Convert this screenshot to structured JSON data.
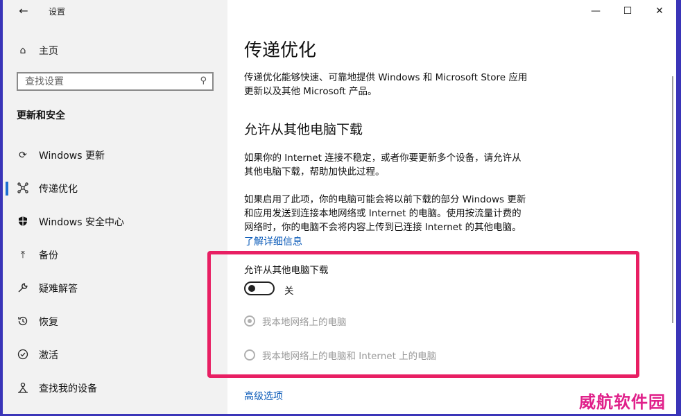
{
  "window": {
    "title": "设置"
  },
  "sidebar": {
    "home_label": "主页",
    "search_placeholder": "查找设置",
    "section_title": "更新和安全",
    "items": [
      {
        "label": "Windows 更新",
        "icon": "sync-icon",
        "active": false
      },
      {
        "label": "传递优化",
        "icon": "delivery-network-icon",
        "active": true
      },
      {
        "label": "Windows 安全中心",
        "icon": "shield-icon",
        "active": false
      },
      {
        "label": "备份",
        "icon": "backup-arrow-icon",
        "active": false
      },
      {
        "label": "疑难解答",
        "icon": "wrench-icon",
        "active": false
      },
      {
        "label": "恢复",
        "icon": "history-icon",
        "active": false
      },
      {
        "label": "激活",
        "icon": "checkmark-circle-icon",
        "active": false
      },
      {
        "label": "查找我的设备",
        "icon": "person-location-icon",
        "active": false
      }
    ]
  },
  "main": {
    "title": "传递优化",
    "description_line1": "传递优化能够快速、可靠地提供 Windows 和 Microsoft Store 应用",
    "description_line2": "更新以及其他 Microsoft 产品。",
    "subheading": "允许从其他电脑下载",
    "para1_line1": "如果你的 Internet 连接不稳定，或者你要更新多个设备，请允许从",
    "para1_line2": "其他电脑下载，帮助加快此过程。",
    "para2_line1": "如果启用了此项，你的电脑可能会将以前下载的部分 Windows 更新",
    "para2_line2": "和应用发送到连接本地网络或 Internet 的电脑。使用按流量计费的",
    "para2_line3": "网络时，你的电脑不会将内容上传到已连接 Internet 的其他电脑。",
    "learn_more": "了解详细信息",
    "toggle_label": "允许从其他电脑下载",
    "toggle_state": "关",
    "toggle_on": false,
    "radio1_label": "我本地网络上的电脑",
    "radio2_label": "我本地网络上的电脑和 Internet 上的电脑",
    "advanced_link": "高级选项"
  },
  "watermark": {
    "text": "威航软件园"
  },
  "colors": {
    "accent": "#1d6fd1",
    "link": "#0a5ab8",
    "highlight": "#e81f63",
    "frame": "#3a35b8"
  }
}
